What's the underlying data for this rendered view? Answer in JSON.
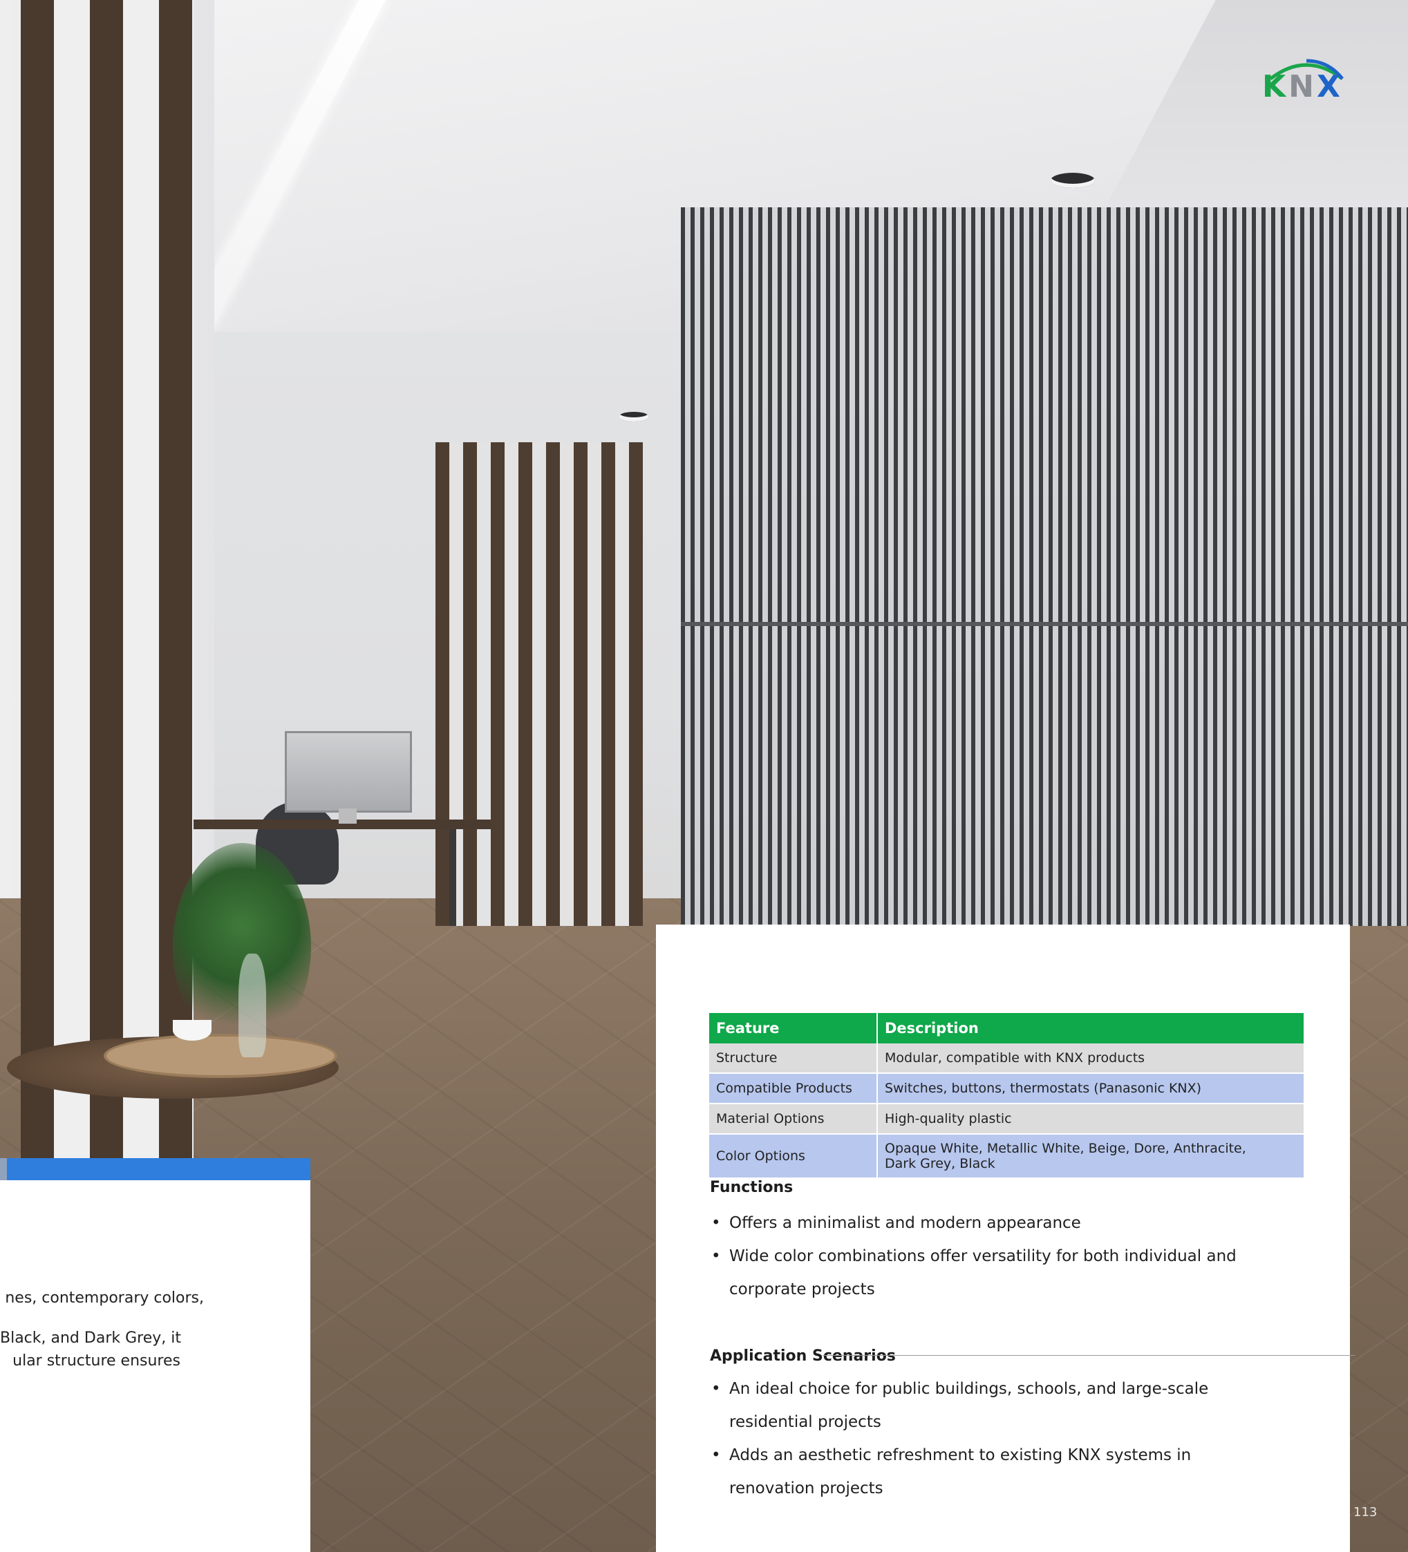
{
  "brand": {
    "logo_text": "KNX",
    "colors": {
      "k": "#1aa54a",
      "n": "#8a8e94",
      "x": "#1f64c8",
      "arc_green": "#1aa54a",
      "arc_blue": "#1f64c8"
    }
  },
  "left_panel": {
    "accent_color": "#2f7ede",
    "lines": [
      "nes, contemporary colors,",
      "Black, and Dark Grey, it",
      "ular structure ensures"
    ]
  },
  "spec_table": {
    "header_color": "#0fa84a",
    "headers": [
      "Feature",
      "Description"
    ],
    "rows": [
      {
        "feature": "Structure",
        "description": "Modular, compatible with KNX products"
      },
      {
        "feature": "Compatible Products",
        "description": "Switches, buttons, thermostats (Panasonic KNX)"
      },
      {
        "feature": "Material Options",
        "description": "High-quality plastic"
      },
      {
        "feature": "Color Options",
        "description_line1": "Opaque White, Metallic White, Beige, Dore, Anthracite,",
        "description_line2": "Dark Grey, Black"
      }
    ]
  },
  "functions": {
    "heading": "Functions",
    "items": [
      "Offers a minimalist and modern appearance",
      "Wide color combinations offer versatility for both individual and",
      "corporate projects"
    ]
  },
  "applications": {
    "heading": "Application Scenarios",
    "items": [
      "An ideal choice for public buildings, schools, and large-scale",
      "residential projects",
      "Adds an aesthetic refreshment to existing KNX systems in",
      "renovation projects"
    ]
  },
  "page_number": "113"
}
